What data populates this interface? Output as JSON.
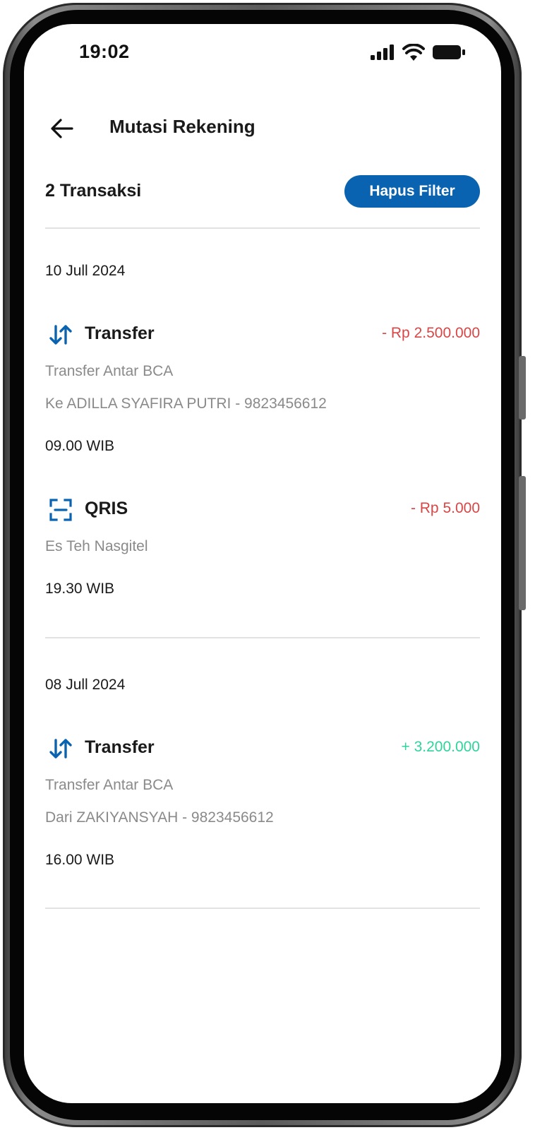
{
  "status_bar": {
    "time": "19:02",
    "icons": [
      "signal-icon",
      "wifi-icon",
      "battery-icon"
    ]
  },
  "header": {
    "title": "Mutasi Rekening",
    "back_icon": "arrow-left-icon"
  },
  "summary": {
    "count_label": "2 Transaksi",
    "clear_filter_label": "Hapus Filter"
  },
  "colors": {
    "brand_blue": "#0a63b0",
    "debit_red": "#d94646",
    "credit_green": "#2fd49a",
    "muted_text": "#8a8a8a"
  },
  "groups": [
    {
      "date": "10 Jull 2024",
      "transactions": [
        {
          "icon": "transfer-arrows-icon",
          "type": "Transfer",
          "amount": "- Rp 2.500.000",
          "direction": "debit",
          "line1": "Transfer Antar BCA",
          "line2": "Ke ADILLA SYAFIRA PUTRI - 9823456612",
          "time": "09.00 WIB"
        },
        {
          "icon": "qris-scan-icon",
          "type": "QRIS",
          "amount": "- Rp 5.000",
          "direction": "debit",
          "line1": "Es Teh Nasgitel",
          "time": "19.30 WIB"
        }
      ]
    },
    {
      "date": "08 Jull 2024",
      "transactions": [
        {
          "icon": "transfer-arrows-icon",
          "type": "Transfer",
          "amount": "+ 3.200.000",
          "direction": "credit",
          "line1": "Transfer Antar BCA",
          "line2": "Dari ZAKIYANSYAH - 9823456612",
          "time": "16.00 WIB"
        }
      ]
    }
  ]
}
